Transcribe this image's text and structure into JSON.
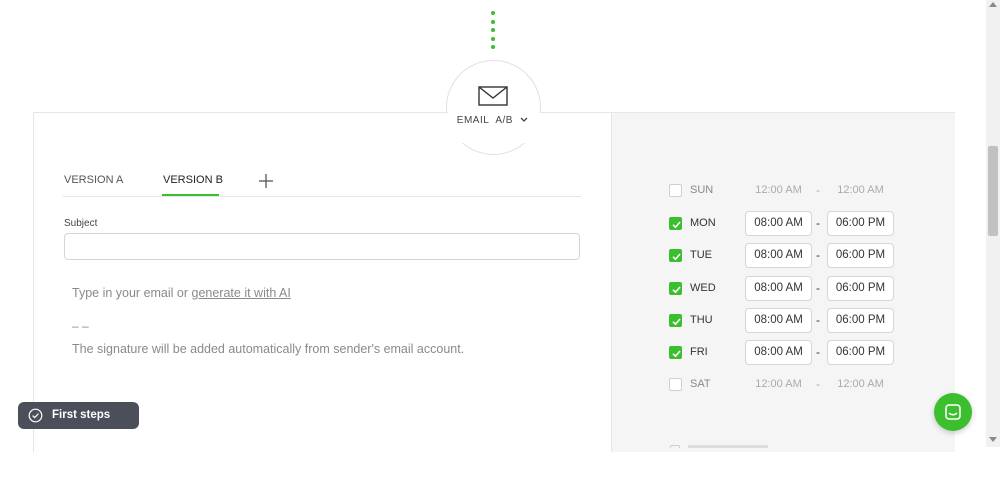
{
  "node": {
    "channel": "EMAIL",
    "ab": "A/B",
    "icon": "envelope-icon"
  },
  "tabs": {
    "version_a": "VERSION A",
    "version_b": "VERSION B",
    "active": "VERSION B"
  },
  "subject": {
    "label": "Subject",
    "value": ""
  },
  "body": {
    "prefix": "Type in your email or ",
    "link": "generate it with AI",
    "signature_dash": "– –",
    "signature_note": "The signature will be added automatically from sender's email account."
  },
  "schedule": {
    "days": [
      {
        "day": "SUN",
        "enabled": false,
        "from": "12:00 AM",
        "to": "12:00 AM"
      },
      {
        "day": "MON",
        "enabled": true,
        "from": "08:00 AM",
        "to": "06:00 PM"
      },
      {
        "day": "TUE",
        "enabled": true,
        "from": "08:00 AM",
        "to": "06:00 PM"
      },
      {
        "day": "WED",
        "enabled": true,
        "from": "08:00 AM",
        "to": "06:00 PM"
      },
      {
        "day": "THU",
        "enabled": true,
        "from": "08:00 AM",
        "to": "06:00 PM"
      },
      {
        "day": "FRI",
        "enabled": true,
        "from": "08:00 AM",
        "to": "06:00 PM"
      },
      {
        "day": "SAT",
        "enabled": false,
        "from": "12:00 AM",
        "to": "12:00 AM"
      }
    ],
    "separator": "-"
  },
  "first_steps": {
    "label": "First steps"
  },
  "colors": {
    "accent": "#3cbf2f",
    "pill_bg": "#4a4f59",
    "panel_bg": "#f5f5f5"
  }
}
